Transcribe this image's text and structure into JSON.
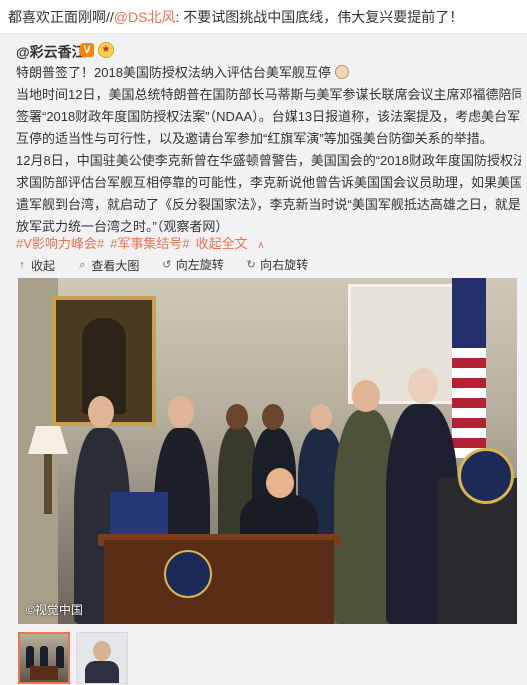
{
  "header": {
    "text_before": "都喜欢正面刚啊//",
    "mention": "@DS北风",
    "text_after": ": 不要试图挑战中国底线，伟大复兴要提前了！"
  },
  "repost": {
    "author": "@彩云香江",
    "verified_badge": "V",
    "lines": [
      "特朗普签了！2018美国防授权法纳入评估台美军舰互停",
      "当地时间12日，美国总统特朗普在国防部长马蒂斯与美军参谋长联席会议主席邓福德陪同下，",
      "签署“2018财政年度国防授权法案”（NDAA）。台媒13日报道称，该法案提及，考虑美台军舰",
      "互停的适当性与可行性，以及邀请台军参加“红旗军演”等加强美台防御关系的举措。",
      "12月8日，中国驻美公使李克新曾在华盛顿曾警告，美国国会的“2018财政年度国防授权法”要",
      "求国防部评估台军舰互相停靠的可能性，李克新说他曾告诉美国国会议员助理，如果美国派",
      "遣军舰到台湾，就启动了《反分裂国家法》，李克新当时说“美国军舰抵达高雄之日，就是我解",
      "放军武力统一台湾之时。”（观察者网）"
    ],
    "tags": [
      "#V影响力峰会#",
      "#军事集结号#"
    ],
    "collapse_label": "收起全文",
    "collapse_chevron": "∧",
    "toolbar": {
      "collapse": "收起",
      "view_large": "查看大图",
      "rotate_left": "向左旋转",
      "rotate_right": "向右旋转"
    },
    "photo": {
      "watermark": "©视觉中国"
    },
    "thumbnails": [
      {
        "name": "thumbnail-signing-photo",
        "selected": true
      },
      {
        "name": "thumbnail-portrait-photo",
        "selected": false
      }
    ]
  },
  "colors": {
    "link": "#eb7350",
    "background": "#f2f2f5",
    "text": "#333333"
  }
}
